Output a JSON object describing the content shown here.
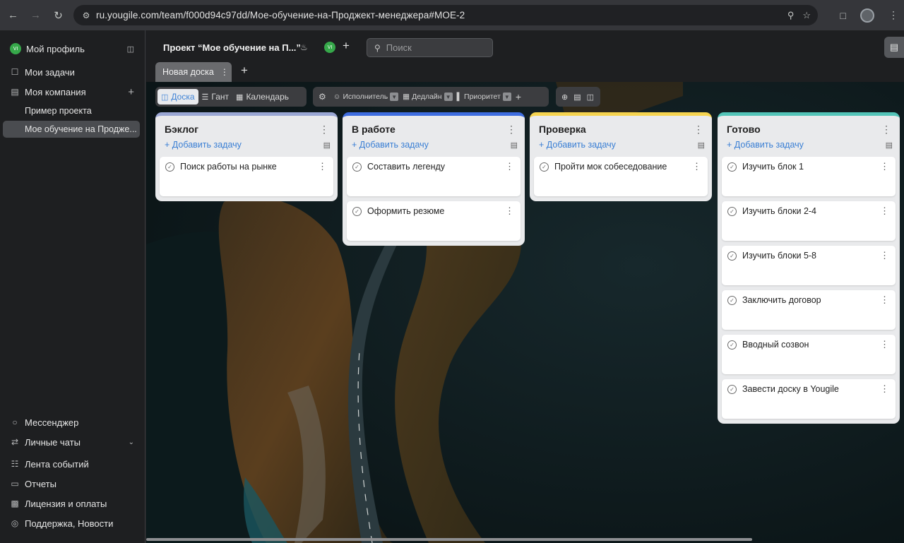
{
  "browser": {
    "url": "ru.yougile.com/team/f000d94c97dd/Мое-обучение-на-Проджект-менеджера#MOE-2"
  },
  "sidebar": {
    "profile": "Мой профиль",
    "avatar_initials": "VI",
    "my_tasks": "Мои задачи",
    "company": "Моя компания",
    "projects": [
      "Пример проекта",
      "Мое обучение на Продже..."
    ],
    "messenger": "Мессенджер",
    "personal_chats": "Личные чаты",
    "event_feed": "Лента событий",
    "reports": "Отчеты",
    "license": "Лицензия и оплаты",
    "support": "Поддержка, Новости"
  },
  "header": {
    "project_title": "Проект “Мое обучение на П...”",
    "user_initials": "VI",
    "search_placeholder": "Поиск",
    "board_tab": "Новая доска"
  },
  "views": {
    "board": "Доска",
    "gantt": "Гант",
    "calendar": "Календарь"
  },
  "filters": {
    "assignee": "Исполнитель",
    "deadline": "Дедлайн",
    "priority": "Приоритет"
  },
  "colors": {
    "backlog": "#9aa7d4",
    "in_progress": "#3e6de0",
    "review": "#f6d450",
    "done": "#53c4b8"
  },
  "columns": [
    {
      "title": "Бэклог",
      "add_label": "+ Добавить задачу",
      "cards": [
        "Поиск работы на рынке"
      ]
    },
    {
      "title": "В работе",
      "add_label": "+ Добавить задачу",
      "cards": [
        "Составить легенду",
        "Оформить резюме"
      ]
    },
    {
      "title": "Проверка",
      "add_label": "+ Добавить задачу",
      "cards": [
        "Пройти мок собеседование"
      ]
    },
    {
      "title": "Готово",
      "add_label": "+ Добавить задачу",
      "cards": [
        "Изучить блок 1",
        "Изучить блоки 2-4",
        "Изучить блоки 5-8",
        "Заключить договор",
        "Вводный созвон",
        "Завести доску в Yougile"
      ]
    }
  ]
}
